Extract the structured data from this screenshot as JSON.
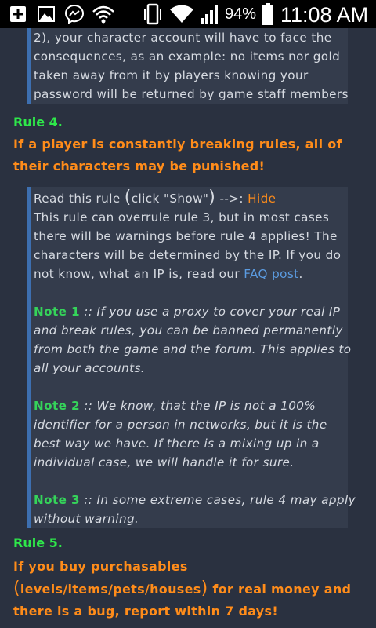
{
  "status_bar": {
    "icons": [
      "add-box-icon",
      "image-icon",
      "messenger-icon",
      "wifi-hotspot-icon",
      "phone-vibrate-icon",
      "wifi-icon",
      "signal-icon",
      "battery-icon"
    ],
    "battery_percent": "94%",
    "time": "11:08 AM"
  },
  "quote1": {
    "lines": [
      "2), your character account will have to face the",
      "consequences, as an example: no items nor gold",
      "taken away from it by players knowing your",
      "password will be returned by game staff members"
    ]
  },
  "rule4": {
    "title": "Rule 4.",
    "text_line1": "If a player is constantly breaking rules, all of",
    "text_line2": "their characters may be punished!"
  },
  "quote2": {
    "show_prefix": "Read this rule ",
    "show_paren_open": "(",
    "show_inner": "click \"Show\"",
    "show_paren_close": ")",
    "show_arrow": " -->: ",
    "hide_link": "Hide",
    "body_lines": [
      "This rule can overrule rule 3, but in most cases",
      "there will be warnings before rule 4 applies! The",
      "characters will be determined by the IP. If you do"
    ],
    "body_last_prefix": "not know, what an IP is, read our ",
    "faq_link": "FAQ post",
    "body_last_suffix": ".",
    "note1_label": "Note 1",
    "note1_sep": " :: ",
    "note1_lines": [
      "If you use a proxy to cover your real IP",
      "and break rules, you can be banned permanently",
      "from both the game and the forum. This applies to",
      "all your accounts."
    ],
    "note2_label": "Note 2",
    "note2_sep": " :: ",
    "note2_lines": [
      "We know, that the IP is not a 100%",
      "identifier for a person in networks, but it is the",
      "best way we have. If there is a mixing up in a",
      "individual case, we will handle it for sure."
    ],
    "note3_label": "Note 3",
    "note3_sep": " :: ",
    "note3_lines": [
      "In some extreme cases, rule 4 may apply",
      "without warning."
    ]
  },
  "rule5": {
    "title": "Rule 5.",
    "text_line1": "If you buy purchasables",
    "paren_open": "(",
    "text_line2_inner": "levels/items/pets/houses",
    "paren_close": ")",
    "text_line2_suffix": " for real money and",
    "text_line3": "there is a bug, report within 7 days!"
  },
  "colors": {
    "background": "#2a3140",
    "quote_background": "#343c4c",
    "quote_border": "#3d6fb0",
    "rule_title": "#2ee84a",
    "rule_text": "#ff8c1a",
    "note_label": "#35d45a",
    "link_blue": "#5b9be0"
  }
}
